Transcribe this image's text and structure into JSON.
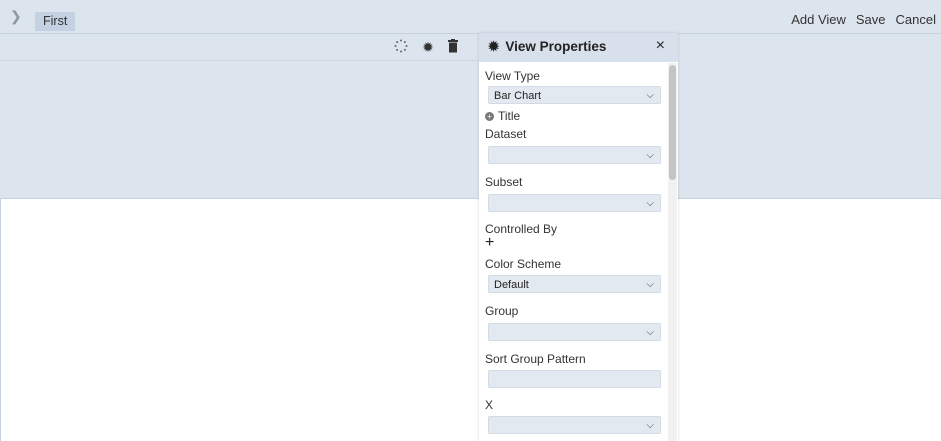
{
  "topbar": {
    "tab_label": "First",
    "actions": {
      "add_view": "Add View",
      "save": "Save",
      "cancel": "Cancel"
    }
  },
  "view_header": {
    "icons": [
      "loading-icon",
      "gear-icon",
      "trash-icon"
    ]
  },
  "panel": {
    "title": "View Properties",
    "close": "×",
    "fields": {
      "view_type_label": "View Type",
      "view_type_value": "Bar Chart",
      "title_toggle": "Title",
      "dataset_label": "Dataset",
      "dataset_value": "",
      "subset_label": "Subset",
      "subset_value": "",
      "controlled_by_label": "Controlled By",
      "color_scheme_label": "Color Scheme",
      "color_scheme_value": "Default",
      "group_label": "Group",
      "group_value": "",
      "sort_group_pattern_label": "Sort Group Pattern",
      "sort_group_pattern_value": "",
      "x_label": "X",
      "x_value": ""
    }
  }
}
